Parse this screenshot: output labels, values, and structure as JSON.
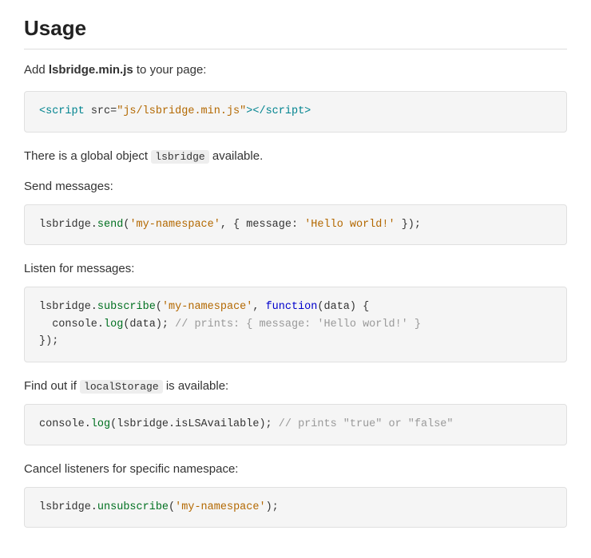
{
  "page": {
    "title": "Usage",
    "intro": {
      "add_text": "Add ",
      "filename": "lsbridge.min.js",
      "add_suffix": " to your page:"
    },
    "code_add_script": "<script src=\"js/lsbridge.min.js\"></script>",
    "global_object_text_before": "There is a global object ",
    "global_object_code": "lsbridge",
    "global_object_text_after": " available.",
    "send_messages_label": "Send messages:",
    "code_send": "lsbridge.send('my-namespace', { message: 'Hello world!' });",
    "listen_messages_label": "Listen for messages:",
    "code_listen_line1": "lsbridge.subscribe('my-namespace', function(data) {",
    "code_listen_line2": "  console.log(data); // prints: { message: 'Hello world!' }",
    "code_listen_line3": "});",
    "find_out_text_before": "Find out if ",
    "find_out_code": "localStorage",
    "find_out_text_after": " is available:",
    "code_find": "console.log(lsbridge.isLSAvailable); // prints \"true\" or \"false\"",
    "cancel_label": "Cancel listeners for specific namespace:",
    "code_cancel": "lsbridge.unsubscribe('my-namespace');"
  }
}
